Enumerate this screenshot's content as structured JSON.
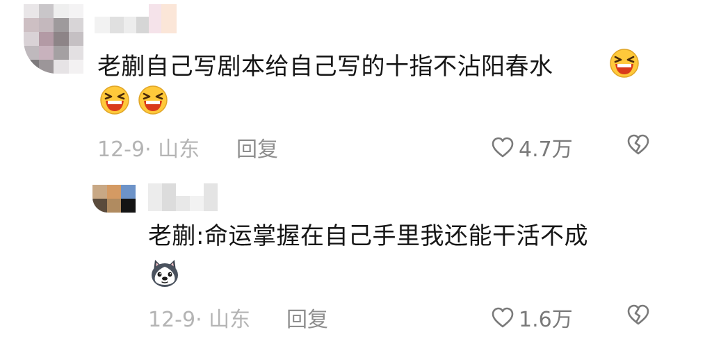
{
  "comments": [
    {
      "text": "老蒯自己写剧本给自己写的十指不沾阳春水",
      "emoji": [
        "laughing-face",
        "laughing-face",
        "laughing-face"
      ],
      "date": "12-9·",
      "location": "山东",
      "reply_label": "回复",
      "likes": "4.7万"
    },
    {
      "text": "老蒯:命运掌握在自己手里我还能干活不成",
      "emoji": [
        "husky-dog-face"
      ],
      "date": "12-9·",
      "location": "山东",
      "reply_label": "回复",
      "likes": "1.6万"
    }
  ],
  "colors": {
    "text": "#161616",
    "meta": "#b4b4b4",
    "reply": "#8e8e8e",
    "icon": "#7a7a7a",
    "emoji_yellow": "#ffc93b",
    "emoji_mouth": "#d93a1a"
  },
  "icons": [
    "heart-outline-icon",
    "broken-heart-icon"
  ]
}
